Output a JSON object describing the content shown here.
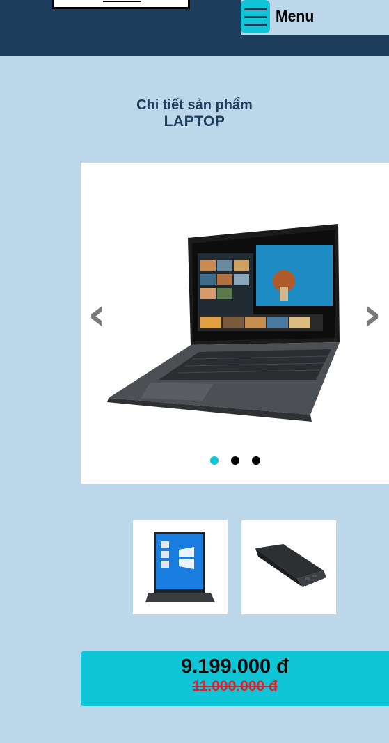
{
  "header": {
    "menu_label": "Menu"
  },
  "heading": {
    "subtitle": "Chi tiết sản phẩm",
    "title": "LAPTOP"
  },
  "carousel": {
    "prev_glyph": "‹",
    "next_glyph": "›",
    "active_slide": 1,
    "slide_count": 3,
    "image": "laptop-open-front-view"
  },
  "thumbnails": [
    {
      "image": "laptop-front-windows-screen"
    },
    {
      "image": "laptop-closed-rear-view"
    }
  ],
  "price": {
    "current": "9.199.000 đ",
    "original": "11.000.000 đ"
  },
  "colors": {
    "header": "#1c3e5c",
    "background": "#bdd7ea",
    "accent": "#0fc5d6",
    "old_price": "#e0202e"
  }
}
